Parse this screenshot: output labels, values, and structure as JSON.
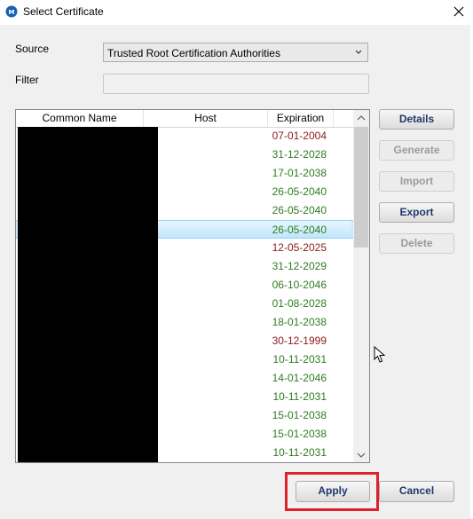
{
  "window": {
    "title": "Select Certificate"
  },
  "form": {
    "source_label": "Source",
    "source_value": "Trusted Root Certification Authorities",
    "filter_label": "Filter",
    "filter_value": ""
  },
  "list": {
    "columns": [
      "Common Name",
      "Host",
      "Expiration"
    ],
    "rows": [
      {
        "expiration": "07-01-2004",
        "status": "expired"
      },
      {
        "expiration": "31-12-2028",
        "status": "valid"
      },
      {
        "expiration": "17-01-2038",
        "status": "valid"
      },
      {
        "expiration": "26-05-2040",
        "status": "valid"
      },
      {
        "expiration": "26-05-2040",
        "status": "valid"
      },
      {
        "expiration": "26-05-2040",
        "status": "valid",
        "selected": true
      },
      {
        "expiration": "12-05-2025",
        "status": "expired"
      },
      {
        "expiration": "31-12-2029",
        "status": "valid"
      },
      {
        "expiration": "06-10-2046",
        "status": "valid"
      },
      {
        "expiration": "01-08-2028",
        "status": "valid"
      },
      {
        "expiration": "18-01-2038",
        "status": "valid"
      },
      {
        "expiration": "30-12-1999",
        "status": "expired"
      },
      {
        "expiration": "10-11-2031",
        "status": "valid"
      },
      {
        "expiration": "14-01-2046",
        "status": "valid"
      },
      {
        "expiration": "10-11-2031",
        "status": "valid"
      },
      {
        "expiration": "15-01-2038",
        "status": "valid"
      },
      {
        "expiration": "15-01-2038",
        "status": "valid"
      },
      {
        "expiration": "10-11-2031",
        "status": "valid"
      }
    ]
  },
  "actions": {
    "details": "Details",
    "generate": "Generate",
    "import": "Import",
    "export": "Export",
    "delete": "Delete"
  },
  "footer": {
    "apply": "Apply",
    "cancel": "Cancel"
  },
  "colors": {
    "valid": "#2e7d1f",
    "expired": "#8b1a1a",
    "highlight": "#e0202a"
  }
}
